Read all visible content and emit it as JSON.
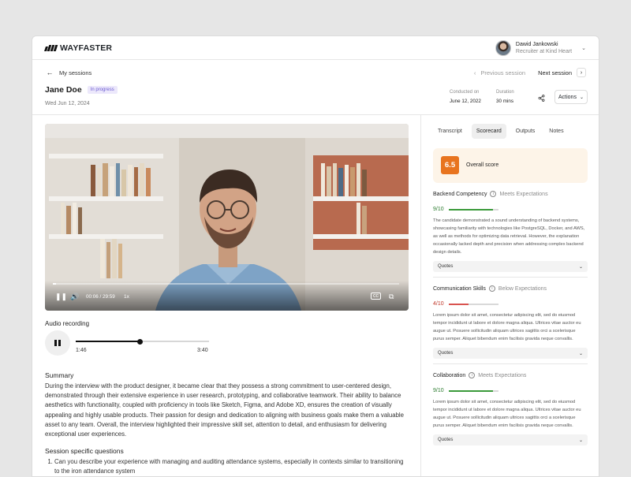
{
  "app": {
    "brand": "WAYFASTER"
  },
  "user": {
    "name": "Dawid Jankowski",
    "role": "Recruiter at Kind Heart",
    "chevron_icon": "chevron-down-icon"
  },
  "header": {
    "back_label": "My sessions",
    "candidate_name": "Jane Doe",
    "status_badge": "In progress",
    "date": "Wed Jun 12, 2024",
    "prev_label": "Previous session",
    "next_label": "Next session",
    "conducted_on_label": "Conducted on",
    "conducted_on_value": "June 12, 2022",
    "duration_label": "Duration",
    "duration_value": "30 mins",
    "actions_label": "Actions"
  },
  "video": {
    "time": "00:06 / 29:59",
    "speed": "1x",
    "progress": 0.01
  },
  "audio": {
    "label": "Audio recording",
    "current": "1:46",
    "total": "3:40",
    "progress": 0.48
  },
  "summary": {
    "title": "Summary",
    "text": "During the interview with the product designer, it became clear that they possess a strong commitment to user-centered design, demonstrated through their extensive experience in user research, prototyping, and collaborative teamwork. Their ability to balance aesthetics with functionality, coupled with proficiency in tools like Sketch, Figma, and Adobe XD, ensures the creation of visually appealing and highly usable products. Their passion for design and dedication to aligning with business goals make them a valuable asset to any team. Overall, the interview highlighted their impressive skill set, attention to detail, and enthusiasm for delivering exceptional user experiences."
  },
  "questions": {
    "title": "Session specific questions",
    "items": [
      "Can you describe your experience with managing and auditing attendance systems, especially in contexts similar to transitioning to the iron attendance system"
    ]
  },
  "tabs": [
    "Transcript",
    "Scorecard",
    "Outputs",
    "Notes"
  ],
  "active_tab": "Scorecard",
  "overall": {
    "score": "6.5",
    "label": "Overall score",
    "color": "#e8741f"
  },
  "competencies": [
    {
      "title": "Backend Competency",
      "status": "Meets Expectations",
      "score": "9/10",
      "value": 0.9,
      "color": "#3a9a3a",
      "text": "The candidate demonstrated a sound understanding of backend systems, showcasing familiarity with technologies like PostgreSQL, Docker, and AWS, as well as methods for optimizing data retrieval. However, the explanation occasionally lacked depth and precision when addressing complex backend design details.",
      "quotes_label": "Quotes"
    },
    {
      "title": "Communication Skills",
      "status": "Below Expectations",
      "score": "4/10",
      "value": 0.4,
      "color": "#d9534f",
      "text": "Lorem ipsum dolor sit amet, consectetur adipiscing elit, sed do eiusmod tempor incididunt ut labore et dolore magna aliqua. Ultrices vitae auctor eu augue ut. Posuere sollicitudin aliquam ultrices sagittis orci a scelerisque purus semper. Aliquet bibendum enim facilisis gravida neque convallis.",
      "quotes_label": "Quotes"
    },
    {
      "title": "Collaboration",
      "status": "Meets Expectations",
      "score": "9/10",
      "value": 0.9,
      "color": "#3a9a3a",
      "text": "Lorem ipsum dolor sit amet, consectetur adipiscing elit, sed do eiusmod tempor incididunt ut labore et dolore magna aliqua. Ultrices vitae auctor eu augue ut. Posuere sollicitudin aliquam ultrices sagittis orci a scelerisque purus semper. Aliquet bibendum enim facilisis gravida neque convallis.",
      "quotes_label": "Quotes"
    }
  ]
}
